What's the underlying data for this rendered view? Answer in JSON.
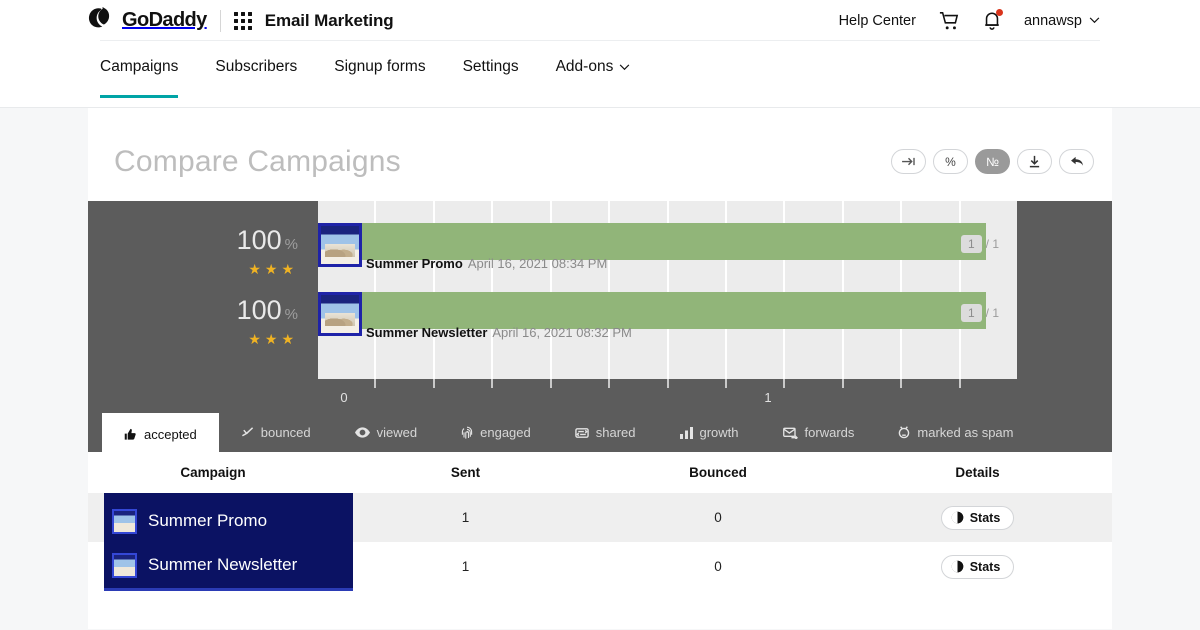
{
  "header": {
    "brand": "GoDaddy",
    "app_name": "Email Marketing",
    "apps_icon": "apps-grid-icon",
    "help_label": "Help Center",
    "cart_icon": "shopping-cart-icon",
    "bell_icon": "notification-bell-icon",
    "account_name": "annawsp",
    "account_caret": "chevron-down-icon"
  },
  "nav": {
    "items": [
      {
        "label": "Campaigns",
        "active": true
      },
      {
        "label": "Subscribers",
        "active": false
      },
      {
        "label": "Signup forms",
        "active": false
      },
      {
        "label": "Settings",
        "active": false
      },
      {
        "label": "Add-ons",
        "active": false,
        "caret": "chevron-down-icon"
      }
    ]
  },
  "page": {
    "title": "Compare Campaigns",
    "toolbar": [
      {
        "name": "expand-button",
        "glyph": "→|",
        "active": false
      },
      {
        "name": "percent-button",
        "glyph": "%",
        "active": false
      },
      {
        "name": "number-button",
        "glyph": "№",
        "active": true
      },
      {
        "name": "download-button",
        "glyph": "⬇",
        "active": false
      },
      {
        "name": "back-button",
        "glyph": "⬅",
        "active": false
      }
    ]
  },
  "chart_data": {
    "type": "bar",
    "title": "Compare Campaigns",
    "xlabel": "",
    "ylabel": "",
    "xlim": [
      0,
      1.8
    ],
    "xticks": [
      0,
      1
    ],
    "xtick_labels": [
      "0",
      "1"
    ],
    "grid": true,
    "legend": "none",
    "bar_color": "#91b579",
    "categories": [
      "Summer Promo",
      "Summer Newsletter"
    ],
    "values": [
      1,
      1
    ],
    "series": [
      {
        "name": "accepted",
        "values": [
          1,
          1
        ]
      }
    ],
    "rows": [
      {
        "percent": "100",
        "percent_unit": "%",
        "stars": "★★★",
        "star_count": 3,
        "name": "Summer Promo",
        "date": "April 16, 2021 08:34 PM",
        "count": "1",
        "total": "/ 1",
        "value": 1
      },
      {
        "percent": "100",
        "percent_unit": "%",
        "stars": "★★★",
        "star_count": 3,
        "name": "Summer Newsletter",
        "date": "April 16, 2021 08:32 PM",
        "count": "1",
        "total": "/ 1",
        "value": 1
      }
    ]
  },
  "metric_tabs": [
    {
      "label": "accepted",
      "icon": "thumbs-up-icon",
      "active": true
    },
    {
      "label": "bounced",
      "icon": "bounce-arrow-icon",
      "active": false
    },
    {
      "label": "viewed",
      "icon": "eye-icon",
      "active": false
    },
    {
      "label": "engaged",
      "icon": "fingerprint-icon",
      "active": false
    },
    {
      "label": "shared",
      "icon": "share-icon",
      "active": false
    },
    {
      "label": "growth",
      "icon": "bar-chart-icon",
      "active": false
    },
    {
      "label": "forwards",
      "icon": "forward-mail-icon",
      "active": false
    },
    {
      "label": "marked as spam",
      "icon": "spam-icon",
      "active": false
    }
  ],
  "table": {
    "columns": [
      "Campaign",
      "Sent",
      "Bounced",
      "Details"
    ],
    "rows": [
      {
        "campaign": "Summer Promo",
        "sent": "1",
        "bounced": "0",
        "details_label": "Stats",
        "details_icon": "pie-chart-icon"
      },
      {
        "campaign": "Summer Newsletter",
        "sent": "1",
        "bounced": "0",
        "details_label": "Stats",
        "details_icon": "pie-chart-icon"
      }
    ]
  },
  "colors": {
    "accent_teal": "#00a4a6",
    "bar_green": "#91b579",
    "chart_bg": "#5c5c5c",
    "plot_bg": "#ececec",
    "campaign_navy": "#0b1263",
    "star_gold": "#f0b323",
    "notif_red": "#d9341b"
  }
}
